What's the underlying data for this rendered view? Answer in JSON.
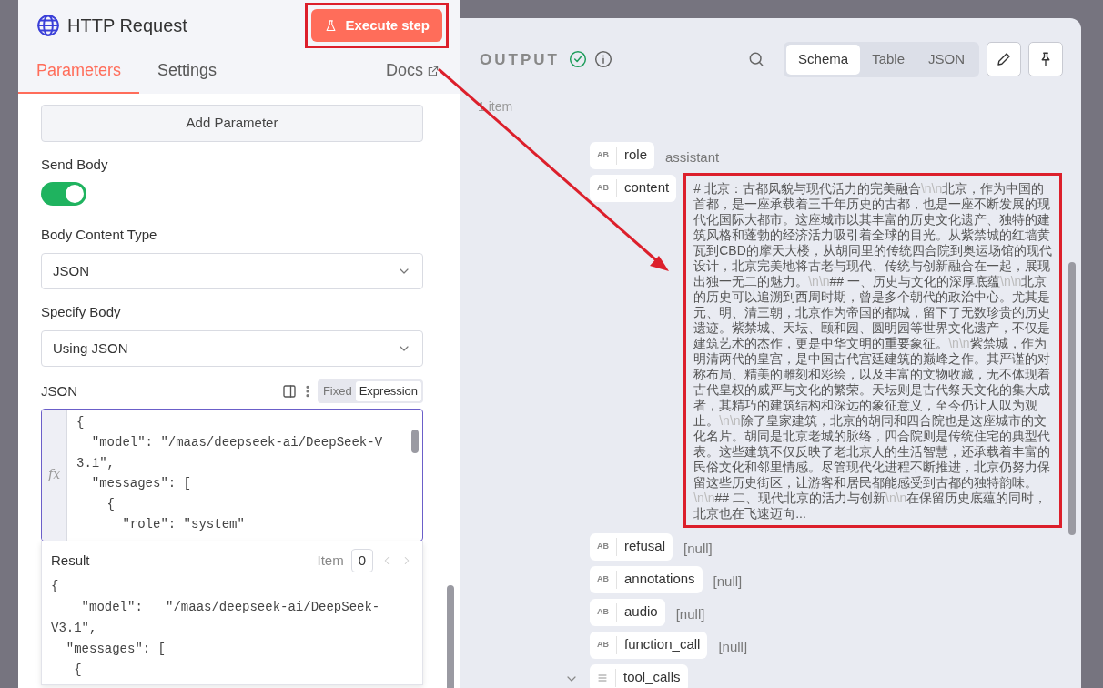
{
  "node": {
    "title": "HTTP Request",
    "execute_button": "Execute step"
  },
  "tabs": [
    {
      "label": "Parameters",
      "selected": true
    },
    {
      "label": "Settings",
      "selected": false
    }
  ],
  "docs_link": "Docs",
  "parameters": {
    "add_button": "Add Parameter",
    "send_body": {
      "label": "Send Body",
      "on": true
    },
    "body_content_type": {
      "label": "Body Content Type",
      "value": "JSON"
    },
    "specify_body": {
      "label": "Specify Body",
      "value": "Using JSON"
    },
    "json_field": {
      "label": "JSON",
      "modes": [
        {
          "label": "Fixed",
          "selected": false
        },
        {
          "label": "Expression",
          "selected": true
        }
      ],
      "gutter": "fx",
      "lines": [
        "{",
        "  \"model\": \"/maas/deepseek-ai/DeepSeek-V",
        "3.1\",",
        "  \"messages\": [",
        "    {",
        "      \"role\": \"system\""
      ]
    }
  },
  "result": {
    "title": "Result",
    "item_label": "Item",
    "item_value": "0",
    "lines": [
      "{",
      "    \"model\":   \"/maas/deepseek-ai/DeepSeek-",
      "V3.1\",",
      "  \"messages\": [",
      "   {"
    ]
  },
  "output": {
    "title": "OUTPUT",
    "views": [
      {
        "label": "Schema",
        "selected": true
      },
      {
        "label": "Table",
        "selected": false
      },
      {
        "label": "JSON",
        "selected": false
      }
    ],
    "count": "1 item",
    "fields": [
      {
        "kind": "string",
        "type_label": "AB",
        "name": "role",
        "value": "assistant"
      },
      {
        "kind": "string",
        "type_label": "AB",
        "name": "content",
        "segments": [
          {
            "kind": "text",
            "text": "# 北京：古都风貌与现代活力的完美融合"
          },
          {
            "kind": "escape",
            "text": "\\n\\n"
          },
          {
            "kind": "text",
            "text": "北京，作为中国的首都，是一座承载着三千年历史的古都，也是一座不断发展的现代化国际大都市。这座城市以其丰富的历史文化遗产、独特的建筑风格和蓬勃的经济活力吸引着全球的目光。从紫禁城的红墙黄瓦到CBD的摩天大楼，从胡同里的传统四合院到奥运场馆的现代设计，北京完美地将古老与现代、传统与创新融合在一起，展现出独一无二的魅力。"
          },
          {
            "kind": "escape",
            "text": "\\n\\n"
          },
          {
            "kind": "text",
            "text": "## 一、历史与文化的深厚底蕴"
          },
          {
            "kind": "escape",
            "text": "\\n\\n"
          },
          {
            "kind": "text",
            "text": "北京的历史可以追溯到西周时期，曾是多个朝代的政治中心。尤其是元、明、清三朝，北京作为帝国的都城，留下了无数珍贵的历史遗迹。紫禁城、天坛、颐和园、圆明园等世界文化遗产，不仅是建筑艺术的杰作，更是中华文明的重要象征。"
          },
          {
            "kind": "escape",
            "text": "\\n\\n"
          },
          {
            "kind": "text",
            "text": "紫禁城，作为明清两代的皇宫，是中国古代宫廷建筑的巅峰之作。其严谨的对称布局、精美的雕刻和彩绘，以及丰富的文物收藏，无不体现着古代皇权的威严与文化的繁荣。天坛则是古代祭天文化的集大成者，其精巧的建筑结构和深远的象征意义，至今仍让人叹为观止。"
          },
          {
            "kind": "escape",
            "text": "\\n\\n"
          },
          {
            "kind": "text",
            "text": "除了皇家建筑，北京的胡同和四合院也是这座城市的文化名片。胡同是北京老城的脉络，四合院则是传统住宅的典型代表。这些建筑不仅反映了老北京人的生活智慧，还承载着丰富的民俗文化和邻里情感。尽管现代化进程不断推进，北京仍努力保留这些历史街区，让游客和居民都能感受到古都的独特韵味。"
          },
          {
            "kind": "escape",
            "text": "\\n\\n"
          },
          {
            "kind": "text",
            "text": "## 二、现代北京的活力与创新"
          },
          {
            "kind": "escape",
            "text": "\\n\\n"
          },
          {
            "kind": "text",
            "text": "在保留历史底蕴的同时，北京也在飞速迈向..."
          }
        ]
      },
      {
        "kind": "string",
        "type_label": "AB",
        "name": "refusal",
        "value": "[null]"
      },
      {
        "kind": "string",
        "type_label": "AB",
        "name": "annotations",
        "value": "[null]"
      },
      {
        "kind": "string",
        "type_label": "AB",
        "name": "audio",
        "value": "[null]"
      },
      {
        "kind": "string",
        "type_label": "AB",
        "name": "function_call",
        "value": "[null]"
      },
      {
        "kind": "list",
        "name": "tool_calls",
        "expanded": true
      }
    ]
  }
}
